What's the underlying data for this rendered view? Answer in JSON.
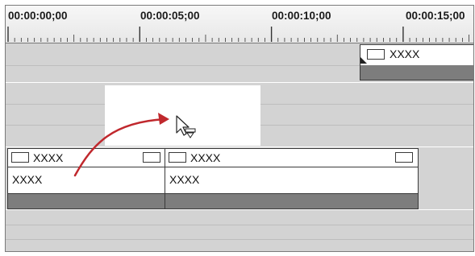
{
  "ruler": {
    "timecodes": [
      "00:00:00;00",
      "00:00:05;00",
      "00:00:10;00",
      "00:00:15;00"
    ]
  },
  "tracks": {
    "top_clip": {
      "name": "XXXX"
    },
    "bottom_clips": [
      {
        "name": "XXXX",
        "sub_label": "XXXX"
      },
      {
        "name": "XXXX",
        "sub_label": "XXXX"
      }
    ]
  },
  "colors": {
    "track_bg": "#d3d3d3",
    "drag_arrow": "#c0282d",
    "clip_bar": "#7d7d7d"
  },
  "icons": {
    "cursor": "drag-insert-cursor-icon",
    "arrow": "curved-arrow-icon"
  }
}
